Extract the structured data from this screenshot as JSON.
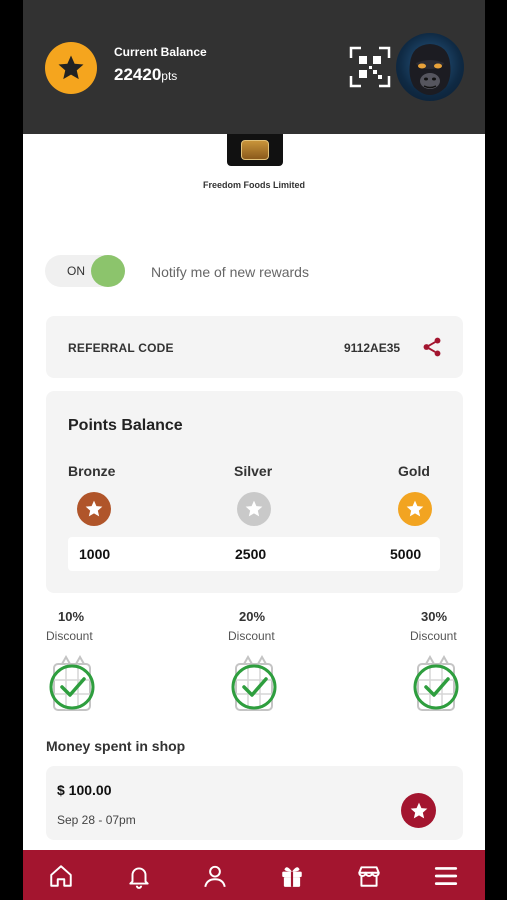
{
  "header": {
    "balance_label": "Current Balance",
    "balance_value": "22420",
    "balance_unit": "pts"
  },
  "merchant": {
    "name": "Freedom Foods Limited"
  },
  "notify": {
    "toggle_state": "ON",
    "label": "Notify me of new rewards"
  },
  "referral": {
    "label": "REFERRAL CODE",
    "code": "9112AE35"
  },
  "points": {
    "title": "Points Balance",
    "tiers": [
      {
        "name": "Bronze",
        "value": "1000",
        "color": "#b0552a"
      },
      {
        "name": "Silver",
        "value": "2500",
        "color": "#c9c9c9"
      },
      {
        "name": "Gold",
        "value": "5000",
        "color": "#f2a421"
      }
    ]
  },
  "discounts": [
    {
      "percent": "10%",
      "label": "Discount"
    },
    {
      "percent": "20%",
      "label": "Discount"
    },
    {
      "percent": "30%",
      "label": "Discount"
    }
  ],
  "money_spent": {
    "title": "Money spent in shop",
    "transactions": [
      {
        "amount": "$ 100.00",
        "date": "Sep 28 - 07pm"
      }
    ]
  },
  "nav": {
    "items": [
      "home-icon",
      "bell-icon",
      "user-icon",
      "gift-icon",
      "store-icon",
      "menu-icon"
    ]
  },
  "colors": {
    "brand": "#a3152f",
    "header_bg": "#323232",
    "accent": "#f5a51e",
    "toggle_on": "#8cc46c",
    "check": "#2e9e3e"
  }
}
